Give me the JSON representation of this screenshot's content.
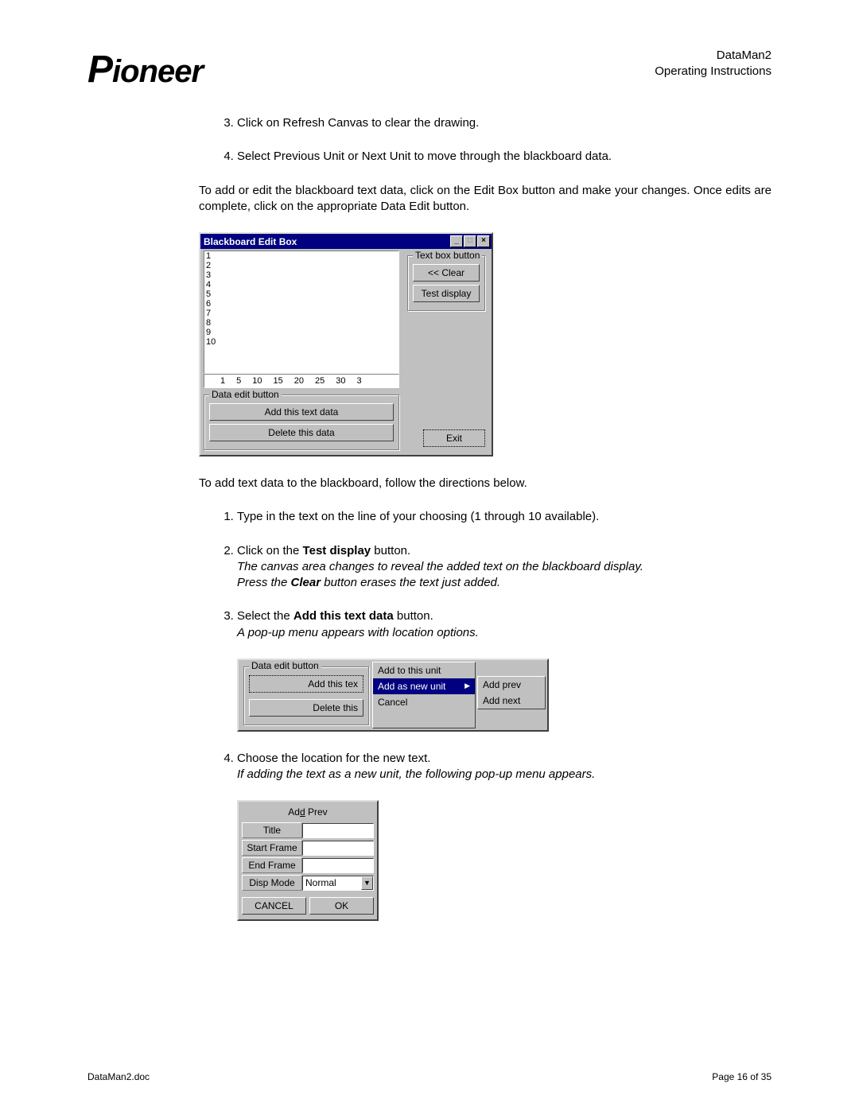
{
  "header": {
    "logo_text": "Pioneer",
    "doc_title": "DataMan2",
    "doc_subtitle": "Operating Instructions"
  },
  "steps_a": [
    "Click on Refresh Canvas to clear the drawing.",
    "Select Previous Unit or Next Unit to move through the blackboard data."
  ],
  "para1": "To add or edit the blackboard text data, click on the Edit Box button and make your changes.  Once edits are complete, click on the appropriate Data Edit button.",
  "win1": {
    "title": "Blackboard Edit Box",
    "rownums": [
      "1",
      "2",
      "3",
      "4",
      "5",
      "6",
      "7",
      "8",
      "9",
      "10"
    ],
    "ruler": [
      "1",
      "5",
      "10",
      "15",
      "20",
      "25",
      "30",
      "3"
    ],
    "data_edit_legend": "Data edit button",
    "add_btn": "Add this text data",
    "del_btn": "Delete this data",
    "textbox_legend": "Text box button",
    "clear_btn": "<< Clear",
    "test_btn": "Test display",
    "exit_btn": "Exit"
  },
  "para2": "To add text data to the blackboard, follow the directions below.",
  "steps_b": {
    "s1": "Type in the text on the line of your choosing (1 through 10 available).",
    "s2_a": "Click on the ",
    "s2_b": "Test display",
    "s2_c": " button.",
    "s2_i1": "The canvas area changes to reveal the added text on the blackboard display.",
    "s2_i2a": "Press the ",
    "s2_i2b": "Clear",
    "s2_i2c": " button erases the text just added.",
    "s3_a": "Select the ",
    "s3_b": "Add this text data",
    "s3_c": " button.",
    "s3_i": "A pop-up menu appears with location options."
  },
  "popup": {
    "legend": "Data edit button",
    "add_this": "Add this tex",
    "del_this": "Delete this",
    "m1": "Add to this unit",
    "m2": "Add as new unit",
    "m3": "Cancel",
    "sub1": "Add prev",
    "sub2": "Add next"
  },
  "steps_c": {
    "s4_a": "Choose the location for the new text.",
    "s4_i": "If adding the text as a new unit, the following pop-up menu appears."
  },
  "dlg": {
    "title": "Add Prev",
    "row1": "Title",
    "row2": "Start Frame",
    "row3": "End Frame",
    "row4": "Disp Mode",
    "mode_val": "Normal",
    "cancel": "CANCEL",
    "ok": "OK"
  },
  "footer": {
    "left": "DataMan2.doc",
    "right": "Page 16 of 35"
  }
}
